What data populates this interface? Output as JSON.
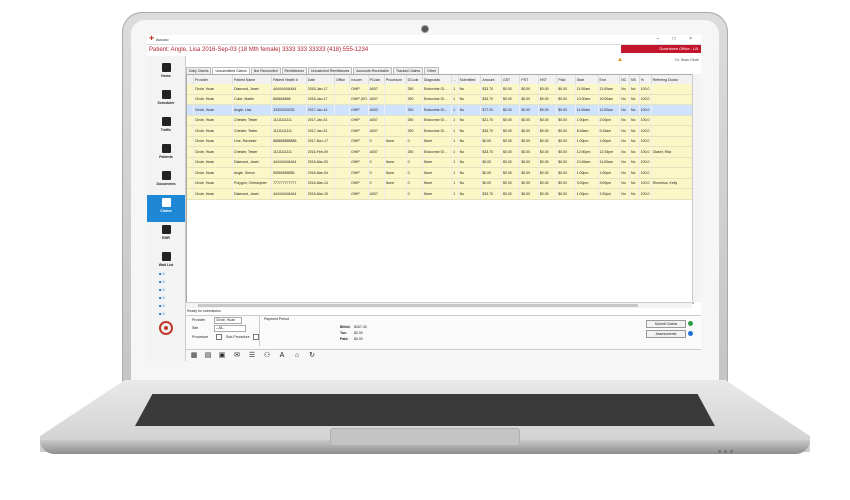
{
  "app": {
    "title": "Accuro",
    "window_controls": "– □ ×"
  },
  "patient": {
    "header": "Patient: Angle, Lisa 2016-Sep-03 (18 Mth female) 3333 333 33333 (418) 555-1234"
  },
  "office": {
    "badge": "Downtown Office - LB",
    "user": "Dr. Huan Circle"
  },
  "sidebar": {
    "items": [
      {
        "label": "Home"
      },
      {
        "label": "Scheduler"
      },
      {
        "label": "Traffic"
      },
      {
        "label": "Patients"
      },
      {
        "label": "Documents"
      },
      {
        "label": "Claims"
      },
      {
        "label": "EMR"
      },
      {
        "label": "Wait List"
      }
    ],
    "mini_counts": [
      "0",
      "0",
      "0",
      "0",
      "0",
      "0",
      "0"
    ]
  },
  "tabs": [
    "Daily Claims",
    "Unsubmitted Claims",
    "Not Reconciled",
    "Remittances",
    "Unmatched Remittances",
    "Accounts Receivable",
    "Tracked Claims",
    "Other"
  ],
  "grid": {
    "columns": [
      "",
      "Provider",
      "Patient Name",
      "Patient Health #",
      "Date",
      "Office",
      "Insurer",
      "PCode",
      "Procedure",
      "DCode",
      "Diagnostic",
      "...",
      "Submitted",
      "Amount",
      "GST",
      "PST",
      "HST",
      "Paid",
      "Start",
      "End",
      "NC",
      "NS",
      "%",
      "Referring Doctor"
    ],
    "rows": [
      [
        "",
        "Circle, Huan",
        "Diamond, Janet",
        "444444444444",
        "2016-Jan-17",
        "",
        "OHIP",
        "A007",
        "",
        "250",
        "Endocrine Gl...",
        "1",
        "No",
        "$33.70",
        "$0.00",
        "$0.00",
        "$0.00",
        "$0.00",
        "11:00am",
        "11:00am",
        "No",
        "No",
        "100.0",
        ""
      ],
      [
        "",
        "Circle, Huan",
        "Cube, Martin",
        "666666666",
        "2016-Jan-17",
        "",
        "OHIP (SO...)",
        "A007",
        "",
        "250",
        "Endocrine Gl...",
        "1",
        "No",
        "$33.70",
        "$0.00",
        "$0.00",
        "$0.00",
        "$0.00",
        "10:00am",
        "10:00am",
        "No",
        "No",
        "100.0",
        ""
      ],
      [
        "",
        "Circle, Huan",
        "Angle, Lisa",
        "33333333333",
        "2017-Jan-14",
        "",
        "OHIP",
        "A003",
        "",
        "250",
        "Endocrine Gl...",
        "1",
        "No",
        "$77.20",
        "$0.00",
        "$0.00",
        "$0.00",
        "$0.00",
        "11:00am",
        "11:00am",
        "No",
        "No",
        "100.0",
        ""
      ],
      [
        "",
        "Circle, Huan",
        "Chester, Tester",
        "11111111111",
        "2017-Jan-31",
        "",
        "OHIP",
        "A007",
        "",
        "250",
        "Endocrine Gl...",
        "1",
        "No",
        "$21.70",
        "$0.00",
        "$0.00",
        "$0.00",
        "$0.00",
        "1:00pm",
        "2:00pm",
        "No",
        "No",
        "100.0",
        ""
      ],
      [
        "",
        "Circle, Huan",
        "Chester, Tester",
        "11111111111",
        "2017-Jan-31",
        "",
        "OHIP",
        "A007",
        "",
        "250",
        "Endocrine Gl...",
        "1",
        "No",
        "$33.70",
        "$0.00",
        "$0.00",
        "$0.00",
        "$0.00",
        "8:45am",
        "9:15am",
        "No",
        "No",
        "100.0",
        ""
      ],
      [
        "",
        "Circle, Huan",
        "Line, Ravinder",
        "888888888888",
        "2017-Nov-17",
        "",
        "OHIP",
        "0",
        "None",
        "0",
        "None",
        "1",
        "No",
        "$0.00",
        "$0.00",
        "$0.00",
        "$0.00",
        "$0.00",
        "1:00pm",
        "1:00pm",
        "No",
        "No",
        "100.0",
        ""
      ],
      [
        "",
        "Circle, Huan",
        "Chester, Tester",
        "11111111111",
        "2016-Feb-09",
        "",
        "OHIP",
        "A007",
        "",
        "250",
        "Endocrine Gl...",
        "1",
        "No",
        "$33.70",
        "$0.00",
        "$0.00",
        "$0.00",
        "$0.00",
        "12:00pm",
        "12:15pm",
        "No",
        "No",
        "100.0",
        "Glaser, Rita"
      ],
      [
        "",
        "Circle, Huan",
        "Diamond, Janet",
        "444444444444",
        "2016-Mar-03",
        "",
        "OHIP",
        "0",
        "None",
        "0",
        "None",
        "1",
        "No",
        "$0.00",
        "$0.00",
        "$0.00",
        "$0.00",
        "$0.00",
        "10:45am",
        "11:00am",
        "No",
        "No",
        "100.0",
        ""
      ],
      [
        "",
        "Circle, Huan",
        "Angle, Simon",
        "55555555555",
        "2016-Mar-04",
        "",
        "OHIP",
        "0",
        "None",
        "0",
        "None",
        "1",
        "No",
        "$0.00",
        "$0.00",
        "$0.00",
        "$0.00",
        "$0.00",
        "1:00pm",
        "1:00pm",
        "No",
        "No",
        "100.0",
        ""
      ],
      [
        "",
        "Circle, Huan",
        "Polygon, Christopher",
        "777777777777",
        "2016-Mar-14",
        "",
        "OHIP",
        "0",
        "None",
        "0",
        "None",
        "1",
        "No",
        "$0.00",
        "$0.00",
        "$0.00",
        "$0.00",
        "$0.00",
        "3:00pm",
        "3:00pm",
        "No",
        "No",
        "100.0",
        "Rhombus, Kelly"
      ],
      [
        "",
        "Circle, Huan",
        "Diamond, Janet",
        "444444444444",
        "2016-Mar-15",
        "",
        "OHIP",
        "A007",
        "",
        "0",
        "None",
        "1",
        "No",
        "$33.70",
        "$0.00",
        "$0.00",
        "$0.00",
        "$0.00",
        "1:00pm",
        "1:00pm",
        "No",
        "No",
        "100.0",
        ""
      ]
    ],
    "selected_row": 2
  },
  "status": {
    "message": "Ready for submission"
  },
  "footer": {
    "provider_label": "Provider",
    "provider_value": "Circle, Huan",
    "site_label": "Site",
    "site_value": "--All--",
    "procedure_label": "Procedure",
    "subprocedure_label": "Sub-Procedure",
    "payment_period_label": "Payment Period",
    "billed_label": "Billed:",
    "billed_value": "$267.40",
    "tax_label": "Tax:",
    "tax_value": "$0.00",
    "paid_label": "Paid:",
    "paid_value": "$0.00",
    "submit_button": "Submit Claims",
    "assessments_button": "Assessments"
  },
  "toolbar_icons": [
    "calendar-icon",
    "clipboard-icon",
    "notes-icon",
    "mail-icon",
    "list-icon",
    "person-icon",
    "font-icon",
    "building-icon",
    "refresh-icon"
  ],
  "colors": {
    "accent_red": "#c3152c",
    "selection": "#cfe3ff",
    "row_yellow": "#fbf7c6",
    "nav_active": "#1e88d6"
  }
}
